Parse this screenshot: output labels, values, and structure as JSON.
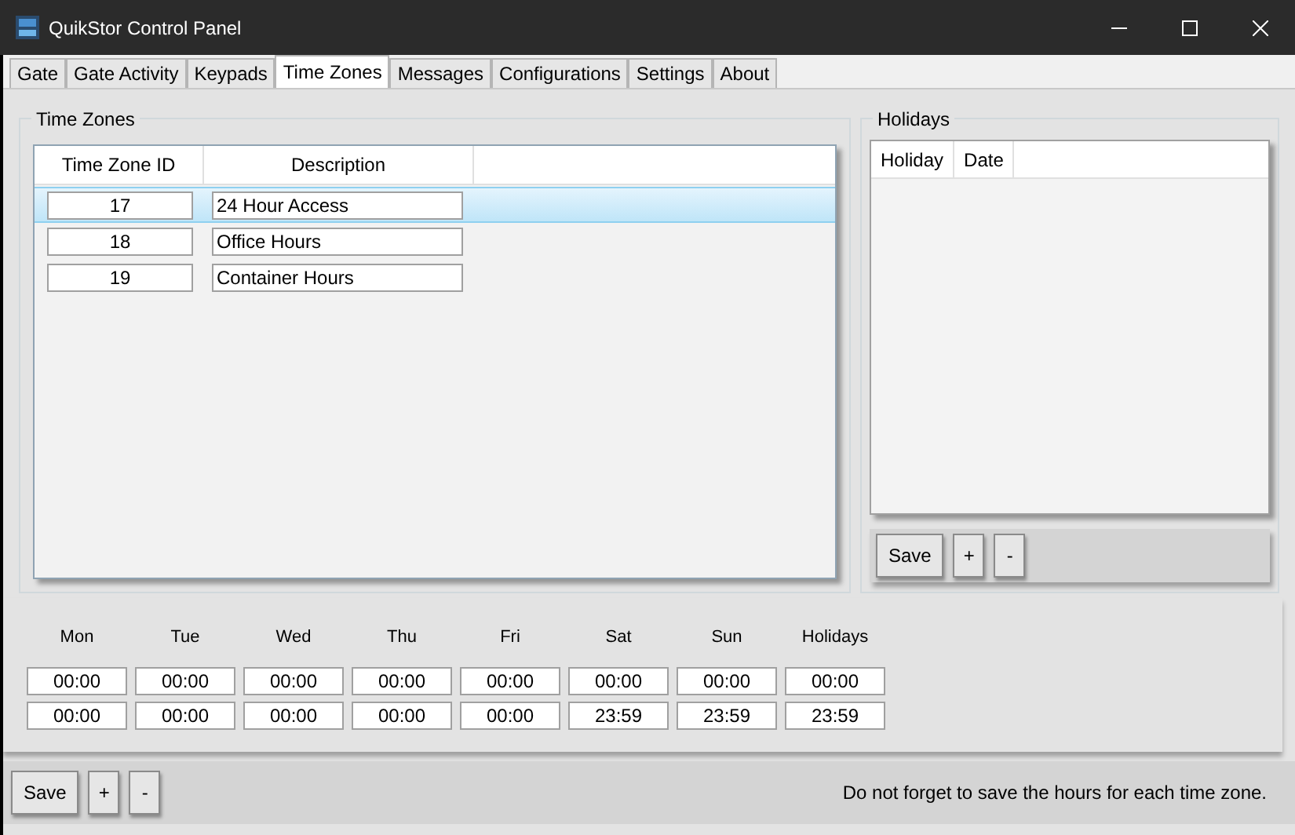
{
  "window": {
    "title": "QuikStor Control Panel"
  },
  "tabs": [
    {
      "label": "Gate",
      "selected": false
    },
    {
      "label": "Gate Activity",
      "selected": false
    },
    {
      "label": "Keypads",
      "selected": false
    },
    {
      "label": "Time Zones",
      "selected": true
    },
    {
      "label": "Messages",
      "selected": false
    },
    {
      "label": "Configurations",
      "selected": false
    },
    {
      "label": "Settings",
      "selected": false
    },
    {
      "label": "About",
      "selected": false
    }
  ],
  "time_zones": {
    "title": "Time Zones",
    "columns": [
      "Time Zone ID",
      "Description"
    ],
    "rows": [
      {
        "id": "17",
        "description": "24 Hour Access",
        "selected": true
      },
      {
        "id": "18",
        "description": "Office Hours",
        "selected": false
      },
      {
        "id": "19",
        "description": "Container Hours",
        "selected": false
      }
    ]
  },
  "holidays": {
    "title": "Holidays",
    "columns": [
      "Holiday",
      "Date"
    ],
    "buttons": [
      "Save",
      "+",
      "-"
    ]
  },
  "hours": {
    "days": [
      "Mon",
      "Tue",
      "Wed",
      "Thu",
      "Fri",
      "Sat",
      "Sun",
      "Holidays"
    ],
    "start": [
      "00:00",
      "00:00",
      "00:00",
      "00:00",
      "00:00",
      "00:00",
      "00:00",
      "00:00"
    ],
    "end": [
      "00:00",
      "00:00",
      "00:00",
      "00:00",
      "00:00",
      "23:59",
      "23:59",
      "23:59"
    ]
  },
  "footer": {
    "buttons": [
      "Save",
      "+",
      "-"
    ],
    "note": "Do not forget to save the hours for each time zone."
  }
}
